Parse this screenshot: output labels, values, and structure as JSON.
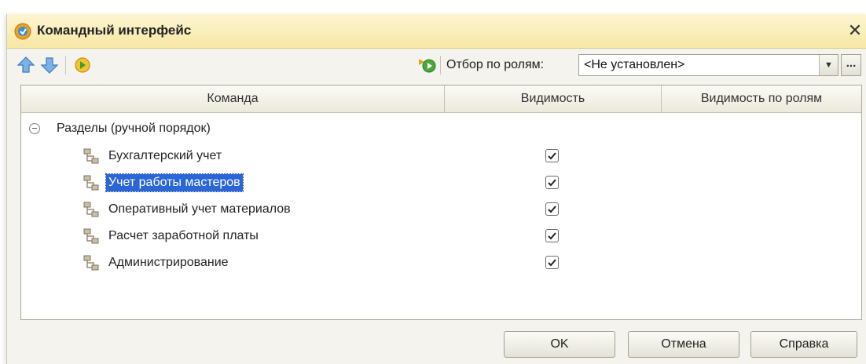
{
  "window": {
    "title": "Командный интерфейс",
    "close_glyph": "✕"
  },
  "toolbar": {
    "move_up_icon": "arrow-up-icon",
    "move_down_icon": "arrow-down-icon",
    "restore_icon": "refresh-icon",
    "apply_icon": "run-icon",
    "filter_label": "Отбор по ролям:",
    "filter_value": "<Не установлен>",
    "filter_dropdown_glyph": "▼",
    "filter_more_glyph": "..."
  },
  "table": {
    "columns": [
      "Команда",
      "Видимость",
      "Видимость по ролям"
    ],
    "group": {
      "label": "Разделы (ручной порядок)",
      "expanded": true
    },
    "rows": [
      {
        "label": "Бухгалтерский учет",
        "visible": true,
        "selected": false
      },
      {
        "label": "Учет работы мастеров",
        "visible": true,
        "selected": true
      },
      {
        "label": "Оперативный учет материалов",
        "visible": true,
        "selected": false
      },
      {
        "label": "Расчет заработной платы",
        "visible": true,
        "selected": false
      },
      {
        "label": "Администрирование",
        "visible": true,
        "selected": false
      }
    ]
  },
  "buttons": {
    "ok": "OK",
    "cancel": "Отмена",
    "help": "Справка"
  },
  "colors": {
    "selection": "#2b66d6",
    "titlebar": "#f7e7a4",
    "window_bg": "#f4f3ee"
  }
}
